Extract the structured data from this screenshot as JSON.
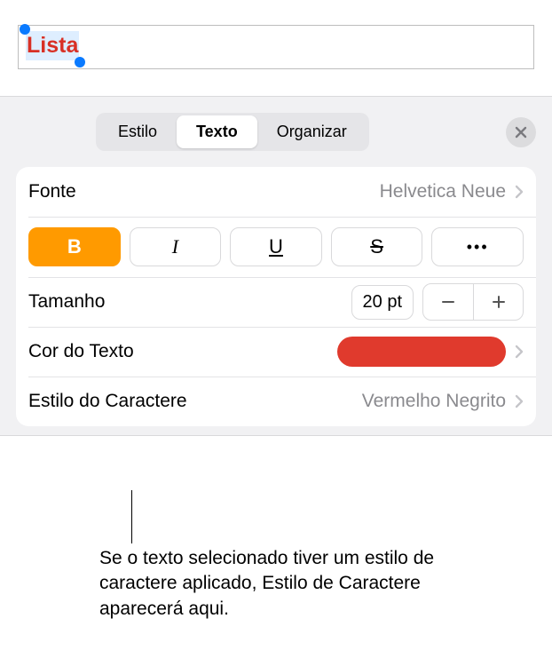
{
  "canvas": {
    "selected_text": "Lista"
  },
  "tabs": {
    "style": "Estilo",
    "text": "Texto",
    "arrange": "Organizar"
  },
  "font": {
    "label": "Fonte",
    "value": "Helvetica Neue"
  },
  "style_buttons": {
    "bold": "B",
    "italic": "I",
    "underline": "U",
    "strike": "S",
    "more": "•••"
  },
  "size": {
    "label": "Tamanho",
    "value": "20 pt"
  },
  "text_color": {
    "label": "Cor do Texto",
    "hex": "#e03a2d"
  },
  "char_style": {
    "label": "Estilo do Caractere",
    "value": "Vermelho Negrito"
  },
  "callout": "Se o texto selecionado tiver um estilo de caractere aplicado, Estilo de Caractere aparecerá aqui."
}
